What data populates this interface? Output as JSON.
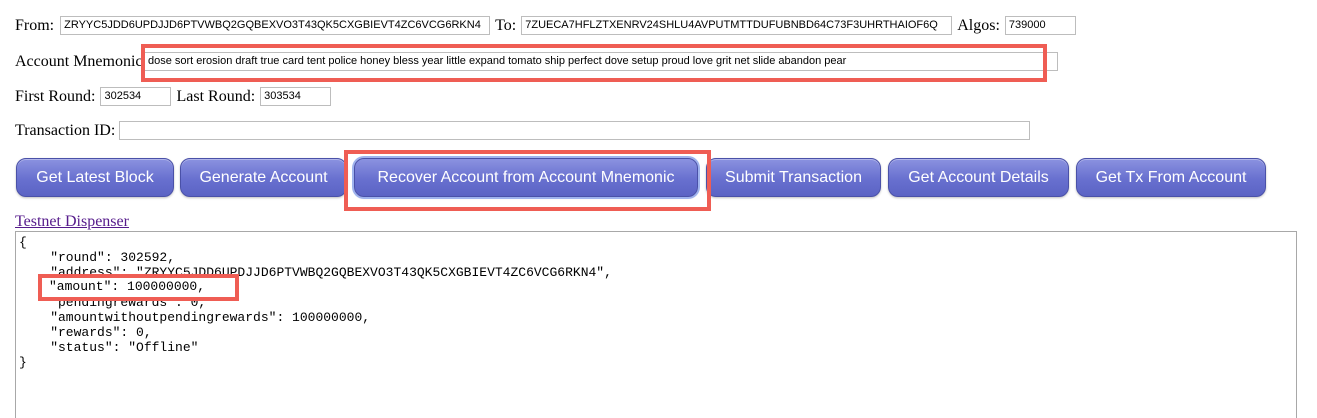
{
  "form": {
    "from_label": "From:",
    "from_value": "ZRYYC5JDD6UPDJJD6PTVWBQ2GQBEXVO3T43QK5CXGBIEVT4ZC6VCG6RKN4",
    "to_label": "To:",
    "to_value": "7ZUECA7HFLZTXENRV24SHLU4AVPUTMTTDUFUBNBD64C73F3UHRTHAIOF6Q",
    "algos_label": "Algos:",
    "algos_value": "739000",
    "mnemonic_label": "Account Mnemonic:",
    "mnemonic_value": "dose sort erosion draft true card tent police honey bless year little expand tomato ship perfect dove setup proud love grit net slide abandon pear",
    "first_round_label": "First Round:",
    "first_round_value": "302534",
    "last_round_label": "Last Round:",
    "last_round_value": "303534",
    "txid_label": "Transaction ID:",
    "txid_value": ""
  },
  "buttons": {
    "get_latest_block": "Get Latest Block",
    "generate_account": "Generate Account",
    "recover_account": "Recover Account from Account Mnemonic",
    "submit_transaction": "Submit Transaction",
    "get_account_details": "Get Account Details",
    "get_tx_from_account": "Get Tx From Account"
  },
  "links": {
    "testnet_dispenser": "Testnet Dispenser"
  },
  "output": {
    "text": "{\n    \"round\": 302592,\n    \"address\": \"ZRYYC5JDD6UPDJJD6PTVWBQ2GQBEXVO3T43QK5CXGBIEVT4ZC6VCG6RKN4\",\n    \"amount\": 100000000,\n    \"pendingrewards\": 0,\n    \"amountwithoutpendingrewards\": 100000000,\n    \"rewards\": 0,\n    \"status\": \"Offline\"\n}"
  },
  "colors": {
    "highlight": "#ef5d54",
    "button": "#6870cf",
    "link_visited": "#551a8b"
  }
}
